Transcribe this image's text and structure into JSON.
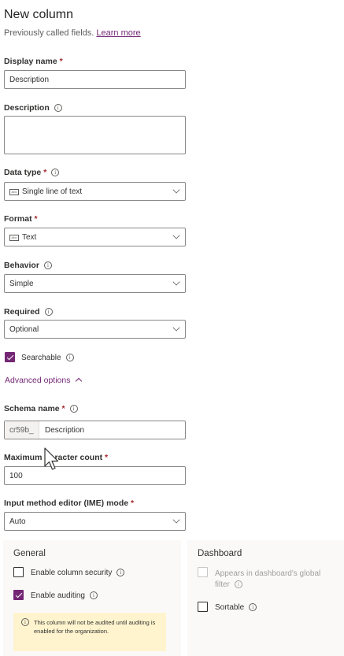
{
  "header": {
    "title": "New column",
    "subtitle": "Previously called fields.",
    "learn_more": "Learn more"
  },
  "display_name": {
    "label": "Display name",
    "value": "Description"
  },
  "description": {
    "label": "Description",
    "value": ""
  },
  "data_type": {
    "label": "Data type",
    "value": "Single line of text",
    "icon": "abc-text-icon"
  },
  "format": {
    "label": "Format",
    "value": "Text",
    "icon": "abc-text-icon"
  },
  "behavior": {
    "label": "Behavior",
    "value": "Simple"
  },
  "required": {
    "label": "Required",
    "value": "Optional"
  },
  "searchable": {
    "label": "Searchable",
    "checked": true
  },
  "advanced_options": {
    "label": "Advanced options",
    "expanded": true
  },
  "schema_name": {
    "label": "Schema name",
    "prefix": "cr59b_",
    "value": "Description"
  },
  "max_char": {
    "label_start": "Maximum",
    "label_end": "racter count",
    "value": "100"
  },
  "ime_mode": {
    "label": "Input method editor (IME) mode",
    "value": "Auto"
  },
  "general": {
    "heading": "General",
    "column_security": {
      "label": "Enable column security",
      "checked": false
    },
    "auditing": {
      "label": "Enable auditing",
      "checked": true
    },
    "notice": "This column will not be audited until auditing is enabled for the organization."
  },
  "dashboard": {
    "heading": "Dashboard",
    "global_filter": {
      "label_line1": "Appears in dashboard's global",
      "label_line2": "filter",
      "checked": false,
      "disabled": true
    },
    "sortable": {
      "label": "Sortable",
      "checked": false
    }
  },
  "colors": {
    "accent": "#742774",
    "required": "#a4262c",
    "notice_bg": "#fff4ce"
  }
}
